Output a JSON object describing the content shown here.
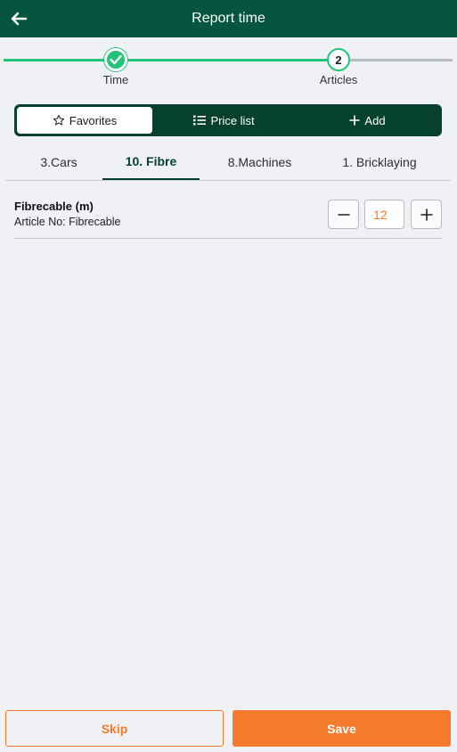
{
  "header": {
    "title": "Report time",
    "back_icon": "arrow-left-icon"
  },
  "stepper": {
    "steps": [
      {
        "label": "Time",
        "state": "done",
        "icon": "check-icon"
      },
      {
        "label": "Articles",
        "number": "2",
        "state": "active"
      }
    ]
  },
  "segmented": {
    "favorites_label": "Favorites",
    "price_list_label": "Price list",
    "add_label": "Add",
    "active": "Favorites"
  },
  "tabs": [
    {
      "label": "3.Cars"
    },
    {
      "label": "10. Fibre",
      "active": true
    },
    {
      "label": "8.Machines"
    },
    {
      "label": "1. Bricklaying"
    }
  ],
  "articles": [
    {
      "name": "Fibrecable (m)",
      "article_no": "Article No: Fibrecable",
      "quantity": "12"
    }
  ],
  "footer": {
    "skip_label": "Skip",
    "save_label": "Save"
  },
  "colors": {
    "header_bg": "#06563f",
    "segmented_bg": "#06412f",
    "progress": "#22c47a",
    "accent": "#f47a2c",
    "background": "#f0f1f5"
  }
}
